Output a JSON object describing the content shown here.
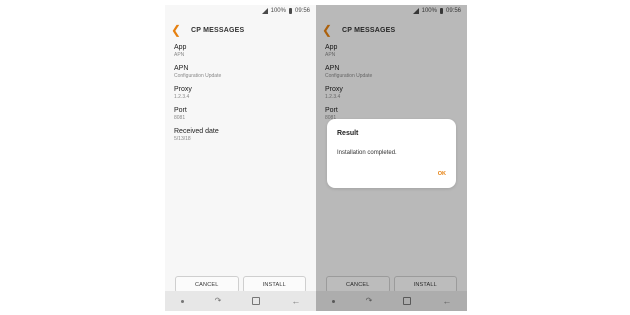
{
  "status": {
    "signal": "📶",
    "battery": "100%",
    "time": "09:56"
  },
  "screen": {
    "title": "CP MESSAGES",
    "items": [
      {
        "label": "App",
        "value": "APN"
      },
      {
        "label": "APN",
        "value": "Configuration Update"
      },
      {
        "label": "Proxy",
        "value": "1.2.3.4"
      },
      {
        "label": "Port",
        "value": "8081"
      },
      {
        "label": "Received date",
        "value": "5/13/18"
      }
    ],
    "cancel_label": "CANCEL",
    "install_label": "INSTALL"
  },
  "dialog": {
    "title": "Result",
    "message": "Installation completed.",
    "ok_label": "OK"
  },
  "colors": {
    "accent": "#e6800f"
  },
  "icons": {
    "back": "chevron-left-icon",
    "nav": [
      "dot-icon",
      "recents-icon",
      "home-icon",
      "back-arrow-icon"
    ]
  }
}
